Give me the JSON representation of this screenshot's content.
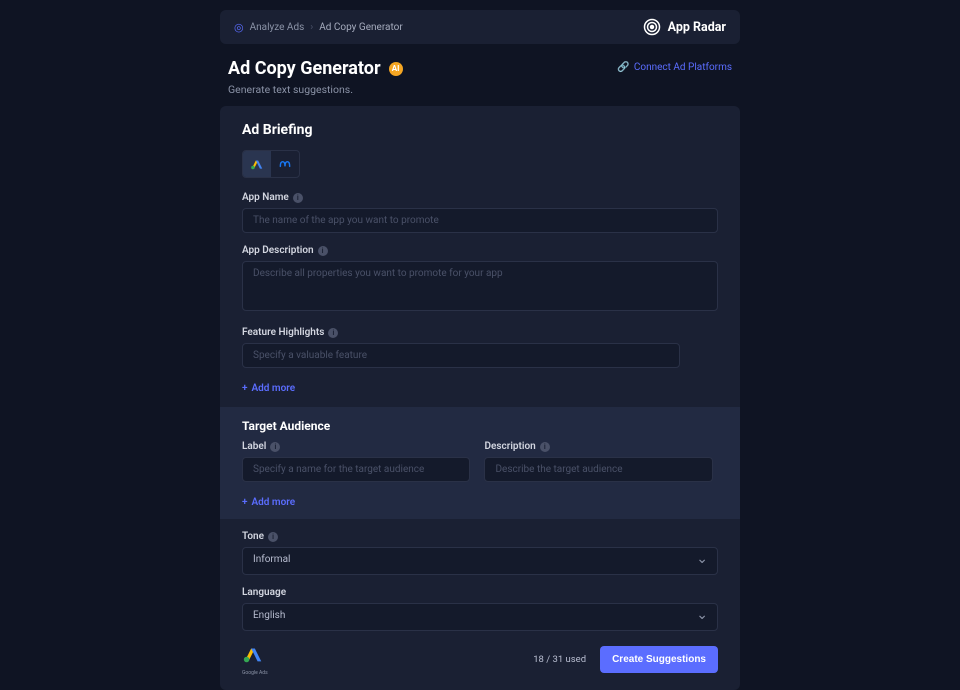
{
  "breadcrumb": {
    "root": "Analyze Ads",
    "current": "Ad Copy Generator"
  },
  "brand": "App Radar",
  "page": {
    "title": "Ad Copy Generator",
    "badge": "AI",
    "subtitle": "Generate text suggestions."
  },
  "connect": "Connect Ad Platforms",
  "briefing": {
    "title": "Ad Briefing",
    "appName": {
      "label": "App Name",
      "placeholder": "The name of the app you want to promote"
    },
    "appDesc": {
      "label": "App Description",
      "placeholder": "Describe all properties you want to promote for your app"
    },
    "features": {
      "label": "Feature Highlights",
      "placeholder": "Specify a valuable feature"
    },
    "addMore": "Add more"
  },
  "audience": {
    "title": "Target Audience",
    "label": {
      "label": "Label",
      "placeholder": "Specify a name for the target audience"
    },
    "desc": {
      "label": "Description",
      "placeholder": "Describe the target audience"
    },
    "addMore": "Add more"
  },
  "tone": {
    "label": "Tone",
    "value": "Informal"
  },
  "language": {
    "label": "Language",
    "value": "English"
  },
  "footer": {
    "google": "Google Ads",
    "usage": "18 / 31 used",
    "cta": "Create Suggestions"
  }
}
